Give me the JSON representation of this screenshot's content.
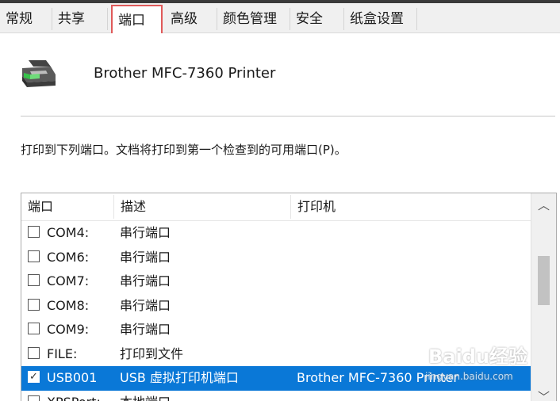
{
  "tabs": [
    {
      "label": "常规",
      "active": false
    },
    {
      "label": "共享",
      "active": false
    },
    {
      "label": "端口",
      "active": true
    },
    {
      "label": "高级",
      "active": false
    },
    {
      "label": "颜色管理",
      "active": false
    },
    {
      "label": "安全",
      "active": false
    },
    {
      "label": "纸盒设置",
      "active": false
    }
  ],
  "printer": {
    "name": "Brother MFC-7360 Printer",
    "icon": "printer-icon"
  },
  "description": "打印到下列端口。文档将打印到第一个检查到的可用端口(P)。",
  "port_list": {
    "columns": [
      "端口",
      "描述",
      "打印机"
    ],
    "rows": [
      {
        "port": "COM4:",
        "desc": "串行端口",
        "printer": "",
        "checked": false
      },
      {
        "port": "COM6:",
        "desc": "串行端口",
        "printer": "",
        "checked": false
      },
      {
        "port": "COM7:",
        "desc": "串行端口",
        "printer": "",
        "checked": false
      },
      {
        "port": "COM8:",
        "desc": "串行端口",
        "printer": "",
        "checked": false
      },
      {
        "port": "COM9:",
        "desc": "串行端口",
        "printer": "",
        "checked": false
      },
      {
        "port": "FILE:",
        "desc": "打印到文件",
        "printer": "",
        "checked": false
      },
      {
        "port": "USB001",
        "desc": "USB 虚拟打印机端口",
        "printer": "Brother MFC-7360 Printer",
        "checked": true,
        "selected": true
      },
      {
        "port": "XPSPort:",
        "desc": "本地端口",
        "printer": "",
        "checked": false
      }
    ],
    "scroll_up_icon": "chevron-up-icon",
    "scroll_down_icon": "chevron-down-icon"
  },
  "watermark": {
    "top": "Baidu经验",
    "bottom": "jingyan.baidu.com"
  },
  "colors": {
    "selection": "#0a78d7",
    "active_tab_border": "#e05a5a"
  }
}
